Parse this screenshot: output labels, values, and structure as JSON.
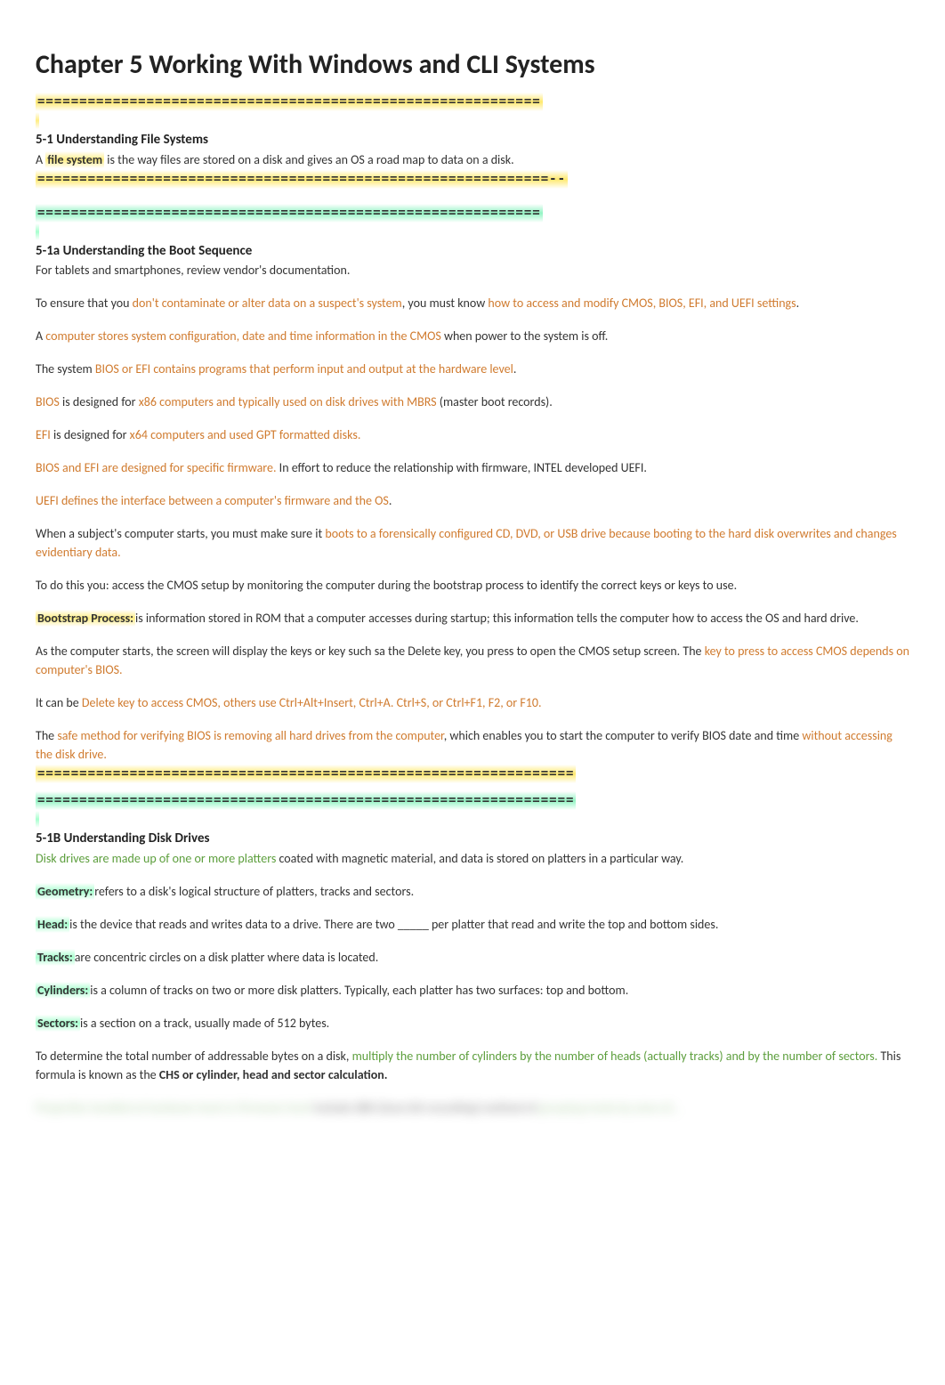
{
  "title": "Chapter 5 Working With Windows and CLI Systems",
  "divider_yellow": "============================================================",
  "divider_yellow_ext": "=============================================================--",
  "divider_green": "============================================================",
  "section1": {
    "heading": "5-1 Understanding File Systems",
    "line1_prefix": "A ",
    "line1_bold": "file system",
    "line1_rest": " is the way files are stored on a disk and gives an OS a road map to data on a disk."
  },
  "section2": {
    "heading": "5-1a Understanding the Boot Sequence",
    "p1": "For tablets and smartphones, review vendor's documentation.",
    "p2_a": "To ensure that you ",
    "p2_b": "don't contaminate or alter data on a suspect's system",
    "p2_c": ", you must know ",
    "p2_d": "how to access and modify CMOS, BIOS, EFI, and UEFI settings",
    "p2_e": ".",
    "p3_a": "A ",
    "p3_b": "computer stores system configuration, date and time information in the CMOS",
    "p3_c": " when power to the system is off.",
    "p4_a": "The system ",
    "p4_b": "BIOS or EFI contains programs that perform input and output at the hardware level",
    "p4_c": ".",
    "p5_a": "BIOS",
    "p5_b": " is designed for ",
    "p5_c": "x86 computers and typically used on disk drives with MBRS",
    "p5_d": " (master boot records).",
    "p6_a": "EFI",
    "p6_b": " is designed for ",
    "p6_c": "x64 computers and used GPT formatted disks.",
    "p7_a": "BIOS and EFI are designed for specific firmware.",
    "p7_b": " In effort to reduce the relationship with firmware, INTEL developed UEFI.",
    "p8_a": "UEFI defines the interface between a computer's firmware and the OS",
    "p8_b": ".",
    "p9_a": "When a subject's computer starts, you must make sure it ",
    "p9_b": "boots to a forensically configured CD, DVD, or USB drive because booting to the hard disk overwrites and changes evidentiary data.",
    "p10": "To do this you: access the CMOS setup by monitoring the computer during the bootstrap process to identify the correct keys or keys to use.",
    "p11_a": "Bootstrap Process:",
    "p11_b": "is information stored in ROM that a computer accesses during startup; this information tells the computer how to access the OS and hard drive.",
    "p12_a": "As the computer starts, the screen will display the keys or key such sa the Delete key, you press to open the CMOS setup screen. The ",
    "p12_b": "key to press to access CMOS depends on computer's BIOS.",
    "p13_a": "It can be ",
    "p13_b": "Delete key to access CMOS, others use Ctrl+Alt+Insert, Ctrl+A. Ctrl+S, or Ctrl+F1, F2, or F10.",
    "p14_a": "The ",
    "p14_b": "safe method for verifying BIOS is removing all hard drives from the computer",
    "p14_c": ", which enables you to start the computer to verify BIOS date and time ",
    "p14_d": "without accessing the disk drive."
  },
  "long_divider_yellow": "================================================================",
  "long_divider_green": "================================================================",
  "section3": {
    "heading": "5-1B Understanding Disk Drives",
    "p1_a": "Disk drives are made up of one or more platters",
    "p1_b": " coated with magnetic material, and data is stored on platters in a particular way.",
    "p2_a": "Geometry:",
    "p2_b": "refers to a disk's logical structure of platters, tracks and sectors.",
    "p3_a": "Head:",
    "p3_b": "is the device that reads and writes data to a drive. There are two _____ per platter that read and write the top and bottom sides.",
    "p4_a": "Tracks:",
    "p4_b": "are concentric circles on a disk platter where data is located.",
    "p5_a": "Cylinders:",
    "p5_b": "is a column of tracks on two or more disk platters. Typically, each platter has two surfaces: top and bottom.",
    "p6_a": "Sectors:",
    "p6_b": "is a section on a track, usually made of 512 bytes.",
    "p7_a": "To determine the total number of addressable bytes on a disk, ",
    "p7_b": "multiply the number of cylinders by the number of heads (actually tracks) and by the number of sectors.",
    "p7_c": " This formula is known as the ",
    "p7_d": "CHS or cylinder, head and sector calculation."
  },
  "blurred": {
    "a": "Properties handled at hardware level or firmware level ",
    "b": "include ZBR (Zone bit recording) method of",
    "c": " grouping tracks by zone of..."
  }
}
